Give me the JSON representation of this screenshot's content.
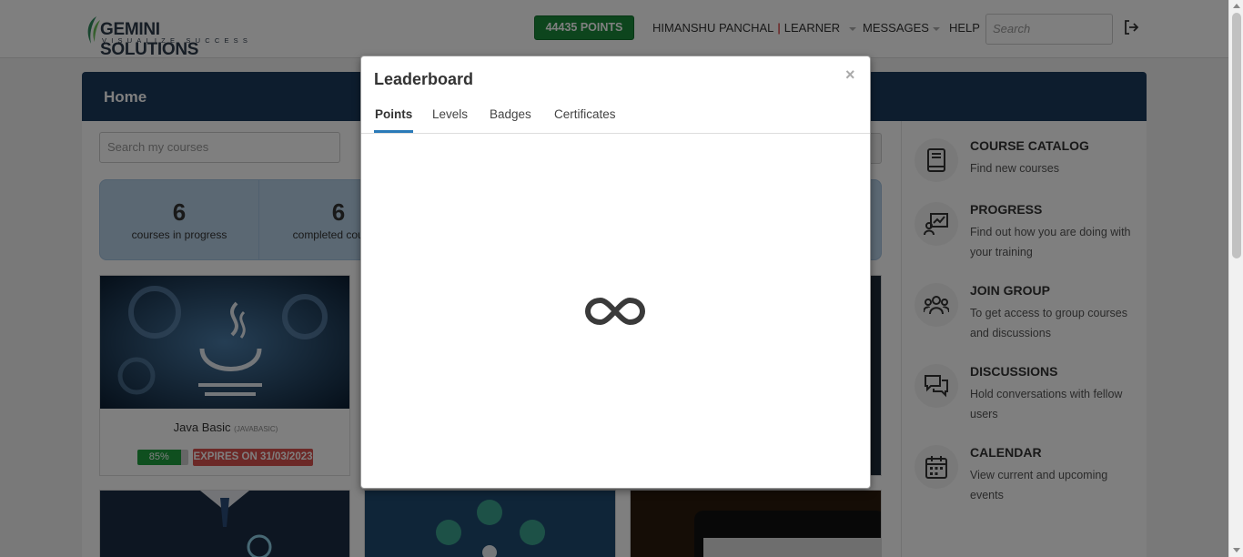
{
  "header": {
    "logo_name": "GEMINI SOLUTIONS",
    "logo_tagline": "VISUALIZE SUCCESS",
    "points_label": "44435 POINTS",
    "user_name": "HIMANSHU PANCHAL",
    "user_role": "LEARNER",
    "messages_label": "MESSAGES",
    "help_label": "HELP",
    "search_placeholder": "Search"
  },
  "page": {
    "title": "Home",
    "search_courses_placeholder": "Search my courses"
  },
  "stats": [
    {
      "value": "6",
      "label": "courses in progress"
    },
    {
      "value": "6",
      "label": "completed courses"
    }
  ],
  "courses": [
    {
      "title": "Java Basic",
      "code": "(JAVABASIC)",
      "progress_label": "85%",
      "progress": 0.85,
      "expiry": "EXPIRES ON 31/03/2023"
    }
  ],
  "sidebar": {
    "items": [
      {
        "title": "COURSE CATALOG",
        "desc": "Find new courses",
        "icon": "book-icon"
      },
      {
        "title": "PROGRESS",
        "desc": "Find out how you are doing with your training",
        "icon": "progress-chart-icon"
      },
      {
        "title": "JOIN GROUP",
        "desc": "To get access to group courses and discussions",
        "icon": "group-icon"
      },
      {
        "title": "DISCUSSIONS",
        "desc": "Hold conversations with fellow users",
        "icon": "chat-bubbles-icon"
      },
      {
        "title": "CALENDAR",
        "desc": "View current and upcoming events",
        "icon": "calendar-icon"
      }
    ]
  },
  "modal": {
    "title": "Leaderboard",
    "close": "×",
    "tabs": [
      {
        "label": "Points",
        "active": true
      },
      {
        "label": "Levels",
        "active": false
      },
      {
        "label": "Badges",
        "active": false
      },
      {
        "label": "Certificates",
        "active": false
      }
    ]
  },
  "colors": {
    "brand_navy": "#1b3a5c",
    "points_green": "#1a8a3a",
    "expiry_red": "#d9534f",
    "tab_accent": "#2a7ab8"
  }
}
